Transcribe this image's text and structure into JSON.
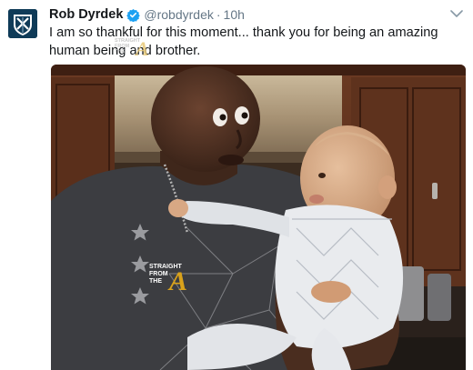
{
  "tweet": {
    "author": {
      "display_name": "Rob Dyrdek",
      "handle": "@robdyrdek",
      "verified": true,
      "avatar_icon": "shield-logo-icon"
    },
    "time": "10h",
    "separator": "·",
    "text": "I am so thankful for this moment... thank you for being an amazing human being and brother.",
    "menu_icon": "chevron-down-icon"
  },
  "watermark": {
    "line1": "STRAIGHT",
    "line2": "FROM",
    "line3": "THE",
    "letter": "A"
  },
  "colors": {
    "verified_blue": "#1da1f2",
    "watermark_gold": "#d9a21b",
    "avatar_bg": "#0f3b58"
  }
}
